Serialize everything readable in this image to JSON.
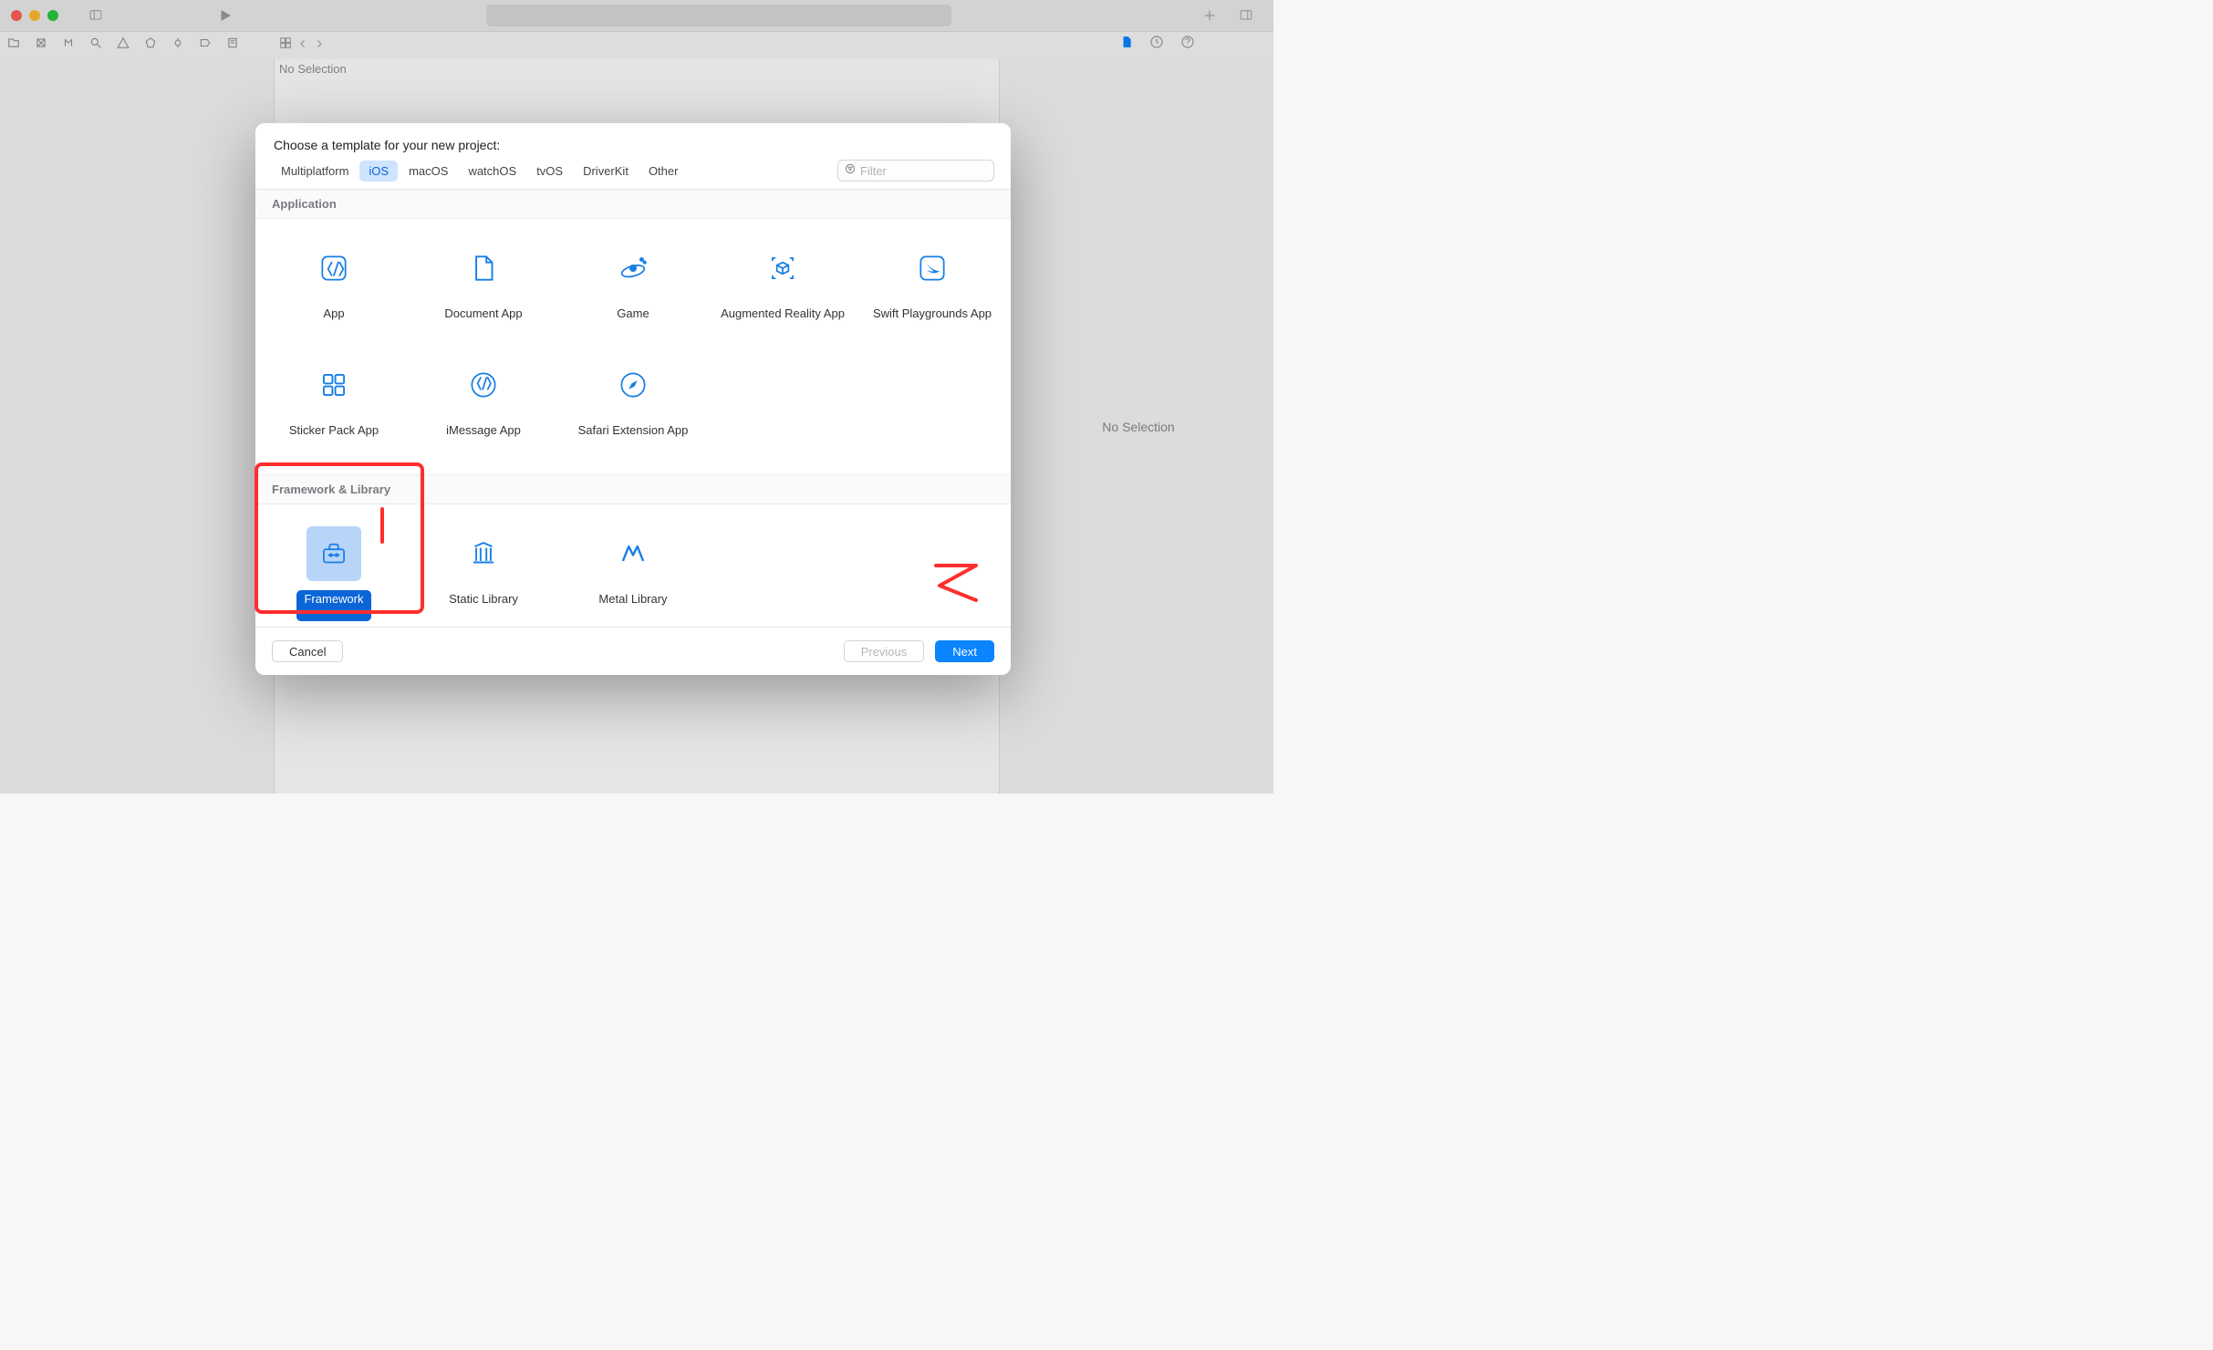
{
  "toolbar": {},
  "inspector": {
    "noSelection": "No Selection"
  },
  "editor": {
    "noSelectionBar": "No Selection"
  },
  "modal": {
    "title": "Choose a template for your new project:",
    "platforms": {
      "0": "Multiplatform",
      "1": "iOS",
      "2": "macOS",
      "3": "watchOS",
      "4": "tvOS",
      "5": "DriverKit",
      "6": "Other"
    },
    "filterPlaceholder": "Filter",
    "sections": {
      "application": {
        "header": "Application",
        "tiles": {
          "0": "App",
          "1": "Document App",
          "2": "Game",
          "3": "Augmented\nReality App",
          "4": "Swift Playgrounds\nApp",
          "5": "Sticker Pack App",
          "6": "iMessage App",
          "7": "Safari Extension\nApp"
        }
      },
      "framework": {
        "header": "Framework & Library",
        "tiles": {
          "0": "Framework",
          "1": "Static Library",
          "2": "Metal Library"
        }
      }
    },
    "footer": {
      "cancel": "Cancel",
      "previous": "Previous",
      "next": "Next"
    }
  }
}
